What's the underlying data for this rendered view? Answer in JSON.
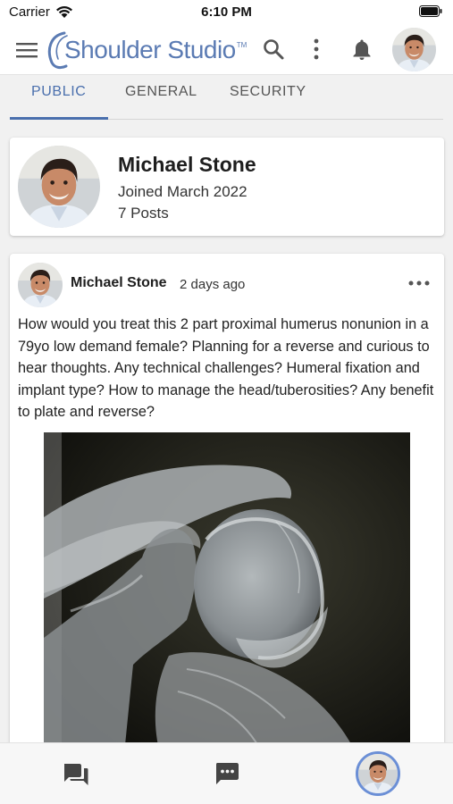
{
  "status_bar": {
    "carrier": "Carrier",
    "time": "6:10 PM"
  },
  "app_bar": {
    "logo_text": "Shoulder Studio",
    "logo_tm": "TM",
    "icons": [
      "menu-icon",
      "search-icon",
      "more-vert-icon",
      "bell-icon"
    ]
  },
  "tabs": [
    {
      "label": "PUBLIC",
      "active": true
    },
    {
      "label": "GENERAL",
      "active": false
    },
    {
      "label": "SECURITY",
      "active": false
    }
  ],
  "profile": {
    "name": "Michael Stone",
    "joined": "Joined March 2022",
    "posts": "7 Posts"
  },
  "post": {
    "author": "Michael Stone",
    "time": "2 days ago",
    "text": "How would you treat this 2 part proximal humerus nonunion in a 79yo low demand female? Planning for a reverse and curious to hear thoughts. Any technical challenges? Humeral fixation and implant type? How to manage the head/tuberosities? Any benefit to plate and reverse?"
  },
  "bottom_nav": {
    "icons": [
      "forum-icon",
      "chat-icon",
      "profile-avatar"
    ]
  },
  "colors": {
    "accent": "#4a6fad",
    "logo": "#5b7bb3",
    "avatar_ring": "#6b8fd6"
  }
}
